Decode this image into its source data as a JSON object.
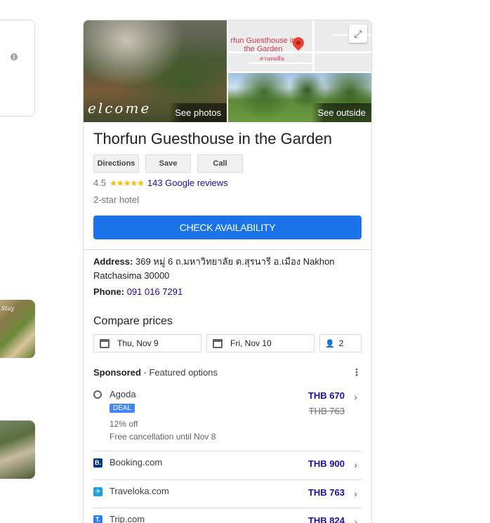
{
  "hotel": {
    "name": "Thorfun Guesthouse in the Garden",
    "rating": "4.5",
    "stars": "★★★★★",
    "reviews": "143 Google reviews",
    "hotel_class": "2-star hotel",
    "address_label": "Address:",
    "address_value": "369 หมู่ 6 ถ.มหาวิทยาลัย ต.สุรนารี อ.เมือง Nakhon Ratchasima 30000",
    "phone_label": "Phone:",
    "phone_value": "091 016 7291"
  },
  "photos": {
    "see_photos": "See photos",
    "see_outside": "See outside",
    "main_photo_text": "elcome",
    "map_title": "rfun Guesthouse in the Garden",
    "map_sub": "สวนทอฝัน"
  },
  "actions": {
    "directions": "Directions",
    "save": "Save",
    "call": "Call",
    "check_availability": "CHECK AVAILABILITY"
  },
  "compare": {
    "title": "Compare prices",
    "check_in": "Thu, Nov 9",
    "check_out": "Fri, Nov 10",
    "guests": "2"
  },
  "sponsored": {
    "label": "Sponsored",
    "separator": " · ",
    "featured": "Featured options"
  },
  "offers": [
    {
      "name": "Agoda",
      "price": "THB 670",
      "old_price": "THB 763",
      "badge": "DEAL",
      "discount": "12% off",
      "note": "Free cancellation until Nov 8"
    },
    {
      "name": "Booking.com",
      "price": "THB 900",
      "logo": "B."
    },
    {
      "name": "Traveloka.com",
      "price": "THB 763",
      "logo": "✈"
    },
    {
      "name": "Trip.com",
      "price": "THB 824",
      "logo": "T."
    }
  ],
  "left": {
    "thumb_text": "Stay"
  },
  "colors": {
    "accent": "#1a73e8",
    "link": "#1a0dab",
    "star": "#fbbc04",
    "booking": "#003580",
    "traveloka": "#1ba0e2",
    "trip": "#287dfa"
  }
}
